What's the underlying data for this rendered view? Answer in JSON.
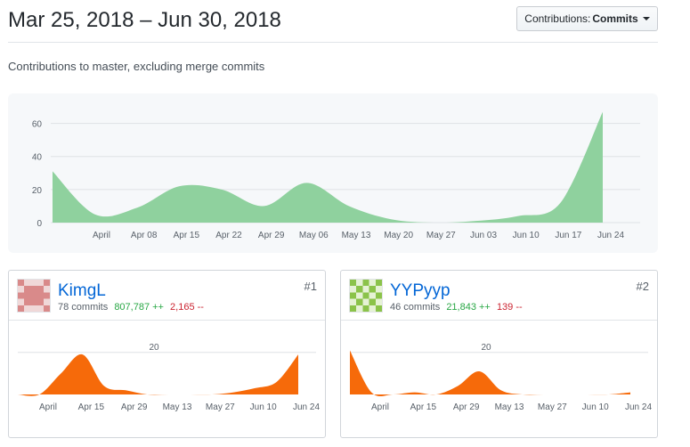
{
  "header": {
    "date_range": "Mar 25, 2018 – Jun 30, 2018",
    "contrib_label": "Contributions:",
    "contrib_value": "Commits"
  },
  "subtitle": "Contributions to master, excluding merge commits",
  "colors": {
    "main_area": "#8fd19e",
    "contributor_area": "#f66a0a",
    "link": "#0366d6",
    "additions": "#28a745",
    "deletions": "#cb2431"
  },
  "chart_data": [
    {
      "type": "area",
      "title": "",
      "ylim": [
        0,
        70
      ],
      "yticks": [
        0,
        20,
        40,
        60
      ],
      "grid": true,
      "x_tick_labels": [
        "April",
        "Apr 08",
        "Apr 15",
        "Apr 22",
        "Apr 29",
        "May 06",
        "May 13",
        "May 20",
        "May 27",
        "Jun 03",
        "Jun 10",
        "Jun 17",
        "Jun 24"
      ],
      "x": [
        "Mar 25",
        "Apr 01",
        "Apr 08",
        "Apr 15",
        "Apr 22",
        "Apr 29",
        "May 06",
        "May 13",
        "May 20",
        "May 27",
        "Jun 03",
        "Jun 10",
        "Jun 17",
        "Jun 24"
      ],
      "values": [
        31,
        5,
        9,
        22,
        20,
        10,
        24,
        10,
        2,
        0,
        1,
        4,
        12,
        67
      ]
    },
    {
      "type": "area",
      "contributor": "KimgL",
      "ylim": [
        0,
        25
      ],
      "yticks": [
        20
      ],
      "x_tick_labels": [
        "April",
        "Apr 15",
        "Apr 29",
        "May 13",
        "May 27",
        "Jun 10",
        "Jun 24"
      ],
      "x": [
        "Mar 25",
        "Apr 01",
        "Apr 08",
        "Apr 15",
        "Apr 22",
        "Apr 29",
        "May 06",
        "May 13",
        "May 20",
        "May 27",
        "Jun 03",
        "Jun 10",
        "Jun 17",
        "Jun 24"
      ],
      "values": [
        0,
        0,
        10,
        19,
        4,
        2,
        0,
        0,
        0,
        0,
        1,
        3,
        6,
        19
      ]
    },
    {
      "type": "area",
      "contributor": "YYPyyp",
      "ylim": [
        0,
        25
      ],
      "yticks": [
        20
      ],
      "x_tick_labels": [
        "April",
        "Apr 15",
        "Apr 29",
        "May 13",
        "May 27",
        "Jun 10",
        "Jun 24"
      ],
      "x": [
        "Mar 25",
        "Apr 01",
        "Apr 08",
        "Apr 15",
        "Apr 22",
        "Apr 29",
        "May 06",
        "May 13",
        "May 20",
        "May 27",
        "Jun 03",
        "Jun 10",
        "Jun 17",
        "Jun 24"
      ],
      "values": [
        21,
        1,
        0,
        1,
        0,
        4,
        11,
        2,
        0,
        0,
        0,
        0,
        0,
        1
      ]
    }
  ],
  "contributors": [
    {
      "name": "KimgL",
      "commits": "78 commits",
      "additions": "807,787 ++",
      "deletions": "2,165 --",
      "rank": "#1",
      "avatar": "pixel-avatar-red"
    },
    {
      "name": "YYPyyp",
      "commits": "46 commits",
      "additions": "21,843 ++",
      "deletions": "139 --",
      "rank": "#2",
      "avatar": "pixel-avatar-green"
    }
  ]
}
